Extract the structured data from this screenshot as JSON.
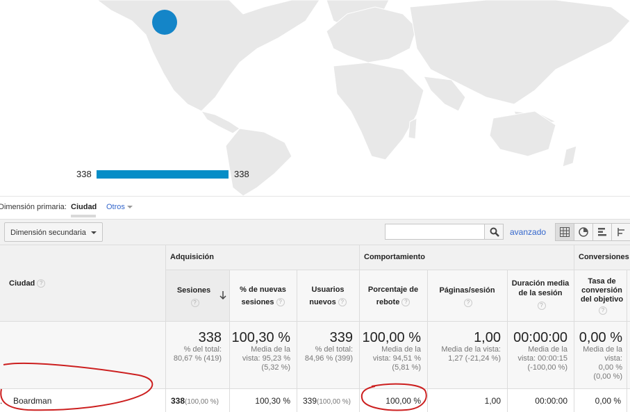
{
  "map": {
    "legend_min": "338",
    "legend_max": "338",
    "bubble_color": "#1485c8",
    "bar_color": "#058dc7"
  },
  "primary_dimension": {
    "label": "Dimensión primaria:",
    "active": "Ciudad",
    "other": "Otros"
  },
  "toolbar": {
    "secondary_dimension": "Dimensión secundaria",
    "search_value": "",
    "advanced": "avanzado",
    "view_icons": [
      "table-view-icon",
      "pie-view-icon",
      "bar-view-icon",
      "pivot-view-icon"
    ]
  },
  "table": {
    "groups": {
      "acquisition": "Adquisición",
      "behavior": "Comportamiento",
      "conversions": "Conversiones"
    },
    "columns": {
      "city": "Ciudad",
      "sessions": "Sesiones",
      "new_sessions_l1": "% de nuevas",
      "new_sessions_l2": "sesiones",
      "new_users_l1": "Usuarios",
      "new_users_l2": "nuevos",
      "bounce_l1": "Porcentaje de",
      "bounce_l2": "rebote",
      "pages": "Páginas/sesión",
      "duration_l1": "Duración media",
      "duration_l2": "de la sesión",
      "conv_l1": "Tasa de",
      "conv_l2": "conversión",
      "conv_l3": "del objetivo"
    },
    "totals": {
      "sessions": "338",
      "sessions_l1": "% del total:",
      "sessions_l2": "80,67 % (419)",
      "new_sessions": "100,30 %",
      "new_sessions_l1": "Media de la",
      "new_sessions_l2": "vista: 95,23 %",
      "new_sessions_l3": "(5,32 %)",
      "new_users": "339",
      "new_users_l1": "% del total:",
      "new_users_l2": "84,96 % (399)",
      "bounce": "100,00 %",
      "bounce_l1": "Media de la",
      "bounce_l2": "vista: 94,51 %",
      "bounce_l3": "(5,81 %)",
      "pages": "1,00",
      "pages_l1": "Media de la vista:",
      "pages_l2": "1,27 (-21,24 %)",
      "duration": "00:00:00",
      "duration_l1": "Media de la",
      "duration_l2": "vista: 00:00:15",
      "duration_l3": "(-100,00 %)",
      "conv": "0,00 %",
      "conv_l1": "Media de la",
      "conv_l2": "vista:",
      "conv_l3": "0,00 %",
      "conv_l4": "(0,00 %)"
    },
    "rows": [
      {
        "row_marker": ".",
        "city": "Boardman",
        "sessions": "338",
        "sessions_pct": "(100,00 %)",
        "new_sessions": "100,30 %",
        "new_users": "339",
        "new_users_pct": "(100,00 %)",
        "bounce": "100,00 %",
        "pages": "1,00",
        "duration": "00:00:00",
        "conv": "0,00 %"
      }
    ],
    "help_glyph": "?"
  },
  "annotation_color": "#cc1f1f"
}
